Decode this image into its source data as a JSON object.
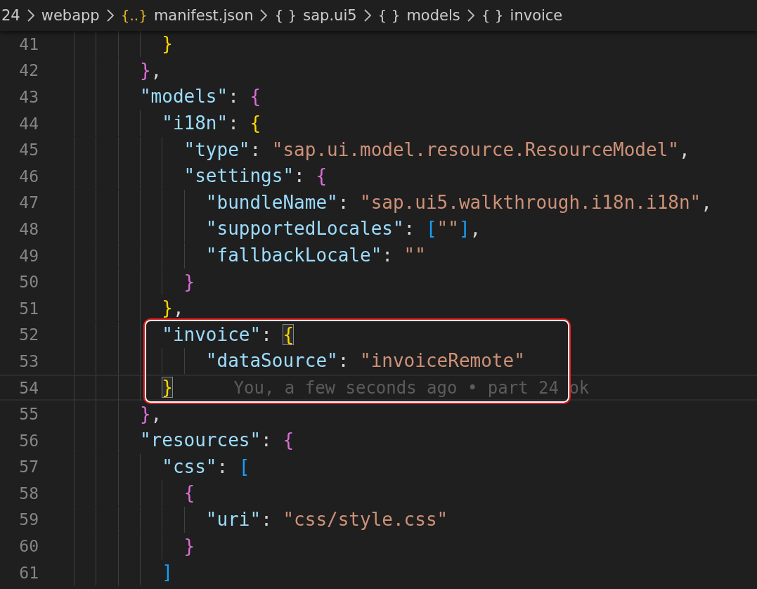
{
  "breadcrumbs": [
    {
      "kind": "folder",
      "text": "24"
    },
    {
      "kind": "folder",
      "text": "webapp"
    },
    {
      "kind": "file",
      "icon": "{..}",
      "text": "manifest.json"
    },
    {
      "kind": "object",
      "icon": "{ }",
      "text": "sap.ui5"
    },
    {
      "kind": "object",
      "icon": "{ }",
      "text": "models"
    },
    {
      "kind": "object",
      "icon": "{ }",
      "text": "invoice"
    }
  ],
  "editor": {
    "lines_above": [
      {
        "number": "41",
        "current": false,
        "tokens": [
          {
            "kind": "bracket",
            "text": "        }",
            "color": "#ffd700",
            "matched": false
          }
        ]
      },
      {
        "number": "42",
        "current": false,
        "tokens": [
          {
            "kind": "bracket",
            "text": "      }",
            "color": "#da70d6",
            "matched": false
          },
          {
            "kind": "punct",
            "text": ","
          }
        ]
      },
      {
        "number": "43",
        "current": false,
        "tokens": [
          {
            "kind": "key",
            "text": "      \"models\""
          },
          {
            "kind": "punct",
            "text": ": "
          },
          {
            "kind": "bracket",
            "text": "{",
            "color": "#da70d6",
            "matched": false
          }
        ]
      },
      {
        "number": "44",
        "current": false,
        "tokens": [
          {
            "kind": "key",
            "text": "        \"i18n\""
          },
          {
            "kind": "punct",
            "text": ": "
          },
          {
            "kind": "bracket",
            "text": "{",
            "color": "#ffd700",
            "matched": false
          }
        ]
      },
      {
        "number": "45",
        "current": false,
        "tokens": [
          {
            "kind": "key",
            "text": "          \"type\""
          },
          {
            "kind": "punct",
            "text": ": "
          },
          {
            "kind": "string",
            "text": "\"sap.ui.model.resource.ResourceModel\""
          },
          {
            "kind": "punct",
            "text": ","
          }
        ]
      },
      {
        "number": "46",
        "current": false,
        "tokens": [
          {
            "kind": "key",
            "text": "          \"settings\""
          },
          {
            "kind": "punct",
            "text": ": "
          },
          {
            "kind": "bracket",
            "text": "{",
            "color": "#da70d6",
            "matched": false
          }
        ]
      },
      {
        "number": "47",
        "current": false,
        "tokens": [
          {
            "kind": "key",
            "text": "            \"bundleName\""
          },
          {
            "kind": "punct",
            "text": ": "
          },
          {
            "kind": "string",
            "text": "\"sap.ui5.walkthrough.i18n.i18n\""
          },
          {
            "kind": "punct",
            "text": ","
          }
        ]
      },
      {
        "number": "48",
        "current": false,
        "tokens": [
          {
            "kind": "key",
            "text": "            \"supportedLocales\""
          },
          {
            "kind": "punct",
            "text": ": "
          },
          {
            "kind": "bracket",
            "text": "[",
            "color": "#179fff",
            "matched": false
          },
          {
            "kind": "string",
            "text": "\"\""
          },
          {
            "kind": "bracket",
            "text": "]",
            "color": "#179fff",
            "matched": false
          },
          {
            "kind": "punct",
            "text": ","
          }
        ]
      },
      {
        "number": "49",
        "current": false,
        "tokens": [
          {
            "kind": "key",
            "text": "            \"fallbackLocale\""
          },
          {
            "kind": "punct",
            "text": ": "
          },
          {
            "kind": "string",
            "text": "\"\""
          }
        ]
      },
      {
        "number": "50",
        "current": false,
        "tokens": [
          {
            "kind": "bracket",
            "text": "          }",
            "color": "#da70d6",
            "matched": false
          }
        ]
      },
      {
        "number": "51",
        "current": false,
        "tokens": [
          {
            "kind": "bracket",
            "text": "        }",
            "color": "#ffd700",
            "matched": false
          },
          {
            "kind": "punct",
            "text": ","
          }
        ]
      }
    ],
    "framed_lines": [
      {
        "number": "52",
        "current": false,
        "tokens": [
          {
            "kind": "key",
            "text": "        \"invoice\""
          },
          {
            "kind": "punct",
            "text": ": "
          },
          {
            "kind": "bracket",
            "text": "{",
            "color": "#ffd700",
            "matched": true
          }
        ]
      },
      {
        "number": "53",
        "current": false,
        "tokens": [
          {
            "kind": "key",
            "text": "            \"dataSource\""
          },
          {
            "kind": "punct",
            "text": ": "
          },
          {
            "kind": "string",
            "text": "\"invoiceRemote\""
          }
        ]
      },
      {
        "number": "54",
        "current": true,
        "tokens": [
          {
            "kind": "bracket",
            "text": "        }",
            "color": "#ffd700",
            "matched": true
          }
        ],
        "blame": "You, a few seconds ago • part 24 ok"
      }
    ],
    "lines_below": [
      {
        "number": "55",
        "current": false,
        "tokens": [
          {
            "kind": "bracket",
            "text": "      }",
            "color": "#da70d6",
            "matched": false
          },
          {
            "kind": "punct",
            "text": ","
          }
        ]
      },
      {
        "number": "56",
        "current": false,
        "tokens": [
          {
            "kind": "key",
            "text": "      \"resources\""
          },
          {
            "kind": "punct",
            "text": ": "
          },
          {
            "kind": "bracket",
            "text": "{",
            "color": "#da70d6",
            "matched": false
          }
        ]
      },
      {
        "number": "57",
        "current": false,
        "tokens": [
          {
            "kind": "key",
            "text": "        \"css\""
          },
          {
            "kind": "punct",
            "text": ": "
          },
          {
            "kind": "bracket",
            "text": "[",
            "color": "#179fff",
            "matched": false
          }
        ]
      },
      {
        "number": "58",
        "current": false,
        "tokens": [
          {
            "kind": "bracket",
            "text": "          {",
            "color": "#da70d6",
            "matched": false
          }
        ]
      },
      {
        "number": "59",
        "current": false,
        "tokens": [
          {
            "kind": "key",
            "text": "            \"uri\""
          },
          {
            "kind": "punct",
            "text": ": "
          },
          {
            "kind": "string",
            "text": "\"css/style.css\""
          }
        ]
      },
      {
        "number": "60",
        "current": false,
        "tokens": [
          {
            "kind": "bracket",
            "text": "          }",
            "color": "#da70d6",
            "matched": false
          }
        ]
      },
      {
        "number": "61",
        "current": false,
        "tokens": [
          {
            "kind": "bracket",
            "text": "        ]",
            "color": "#179fff",
            "matched": false
          }
        ]
      }
    ]
  }
}
